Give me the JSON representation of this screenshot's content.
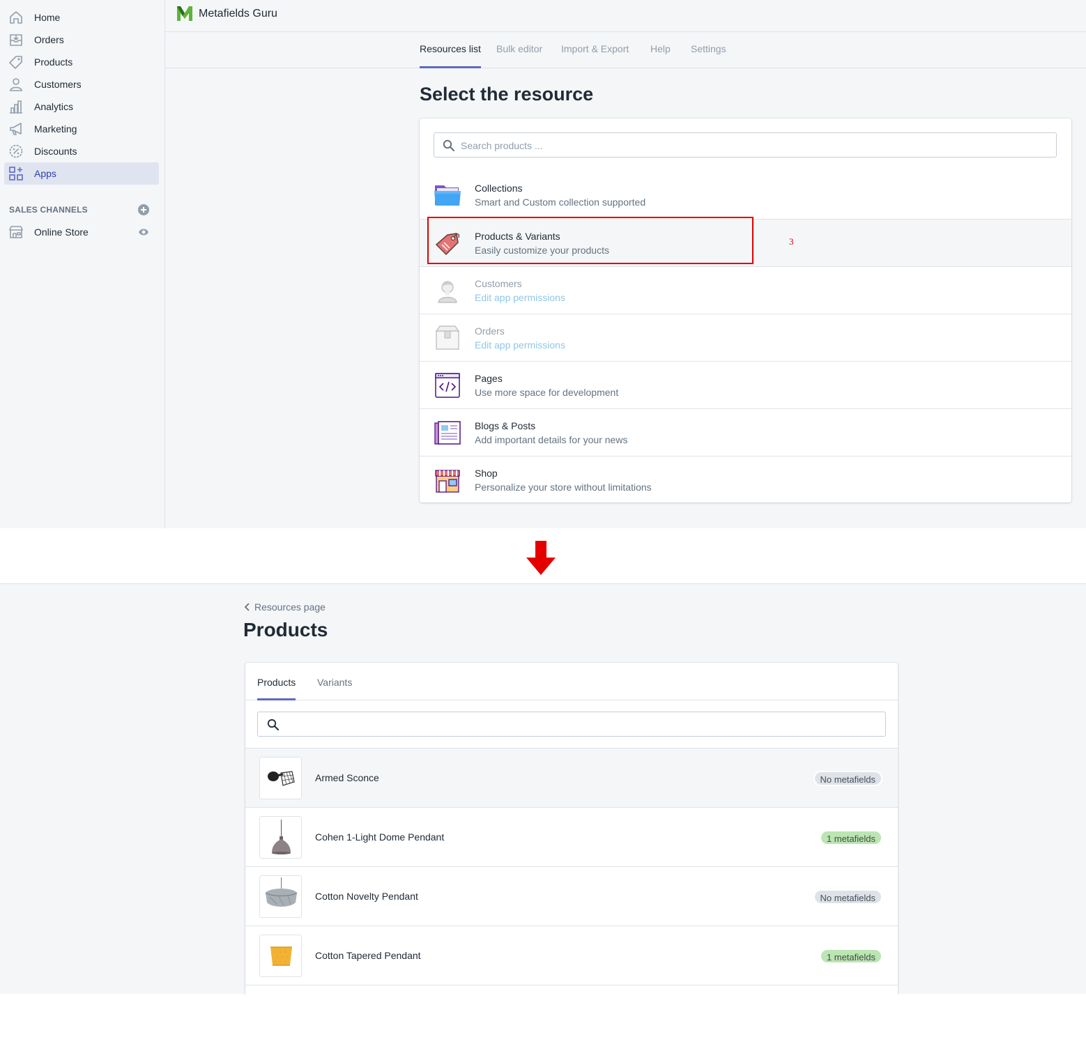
{
  "sidebar": {
    "items": [
      {
        "label": "Home",
        "icon": "home-icon"
      },
      {
        "label": "Orders",
        "icon": "orders-icon"
      },
      {
        "label": "Products",
        "icon": "tag-icon"
      },
      {
        "label": "Customers",
        "icon": "person-icon"
      },
      {
        "label": "Analytics",
        "icon": "bar-chart-icon"
      },
      {
        "label": "Marketing",
        "icon": "megaphone-icon"
      },
      {
        "label": "Discounts",
        "icon": "discount-icon"
      },
      {
        "label": "Apps",
        "icon": "apps-icon",
        "active": true
      }
    ],
    "sales_channels_label": "SALES CHANNELS",
    "online_store_label": "Online Store"
  },
  "app": {
    "title": "Metafields Guru"
  },
  "tabs": [
    {
      "label": "Resources list",
      "active": true
    },
    {
      "label": "Bulk editor"
    },
    {
      "label": "Import & Export"
    },
    {
      "label": "Help"
    },
    {
      "label": "Settings"
    }
  ],
  "resources_page": {
    "title": "Select the resource",
    "search_placeholder": "Search products ...",
    "rows": [
      {
        "title": "Collections",
        "subtitle": "Smart and Custom collection supported",
        "icon": "folder-icon"
      },
      {
        "title": "Products & Variants",
        "subtitle": "Easily customize your products",
        "icon": "price-tag-icon"
      },
      {
        "title": "Customers",
        "subtitle": "Edit app permissions",
        "icon": "customer-avatar-icon",
        "disabled": true
      },
      {
        "title": "Orders",
        "subtitle": "Edit app permissions",
        "icon": "box-icon",
        "disabled": true
      },
      {
        "title": "Pages",
        "subtitle": "Use more space for development",
        "icon": "code-page-icon"
      },
      {
        "title": "Blogs & Posts",
        "subtitle": "Add important details for your news",
        "icon": "newspaper-icon"
      },
      {
        "title": "Shop",
        "subtitle": "Personalize your store without limitations",
        "icon": "storefront-icon"
      }
    ],
    "step_annotation": "3"
  },
  "colors": {
    "accent": "#5c6ac4",
    "highlight": "#e00000",
    "badge_green": "#bbe5b3",
    "badge_grey": "#dfe3e8"
  },
  "products_page": {
    "back_label": "Resources page",
    "title": "Products",
    "tabs": [
      {
        "label": "Products",
        "active": true
      },
      {
        "label": "Variants"
      }
    ],
    "search_value": "",
    "items": [
      {
        "name": "Armed Sconce",
        "badge": "No metafields",
        "has": false
      },
      {
        "name": "Cohen 1-Light Dome Pendant",
        "badge": "1 metafields",
        "has": true
      },
      {
        "name": "Cotton Novelty Pendant",
        "badge": "No metafields",
        "has": false
      },
      {
        "name": "Cotton Tapered Pendant",
        "badge": "1 metafields",
        "has": true
      }
    ]
  }
}
